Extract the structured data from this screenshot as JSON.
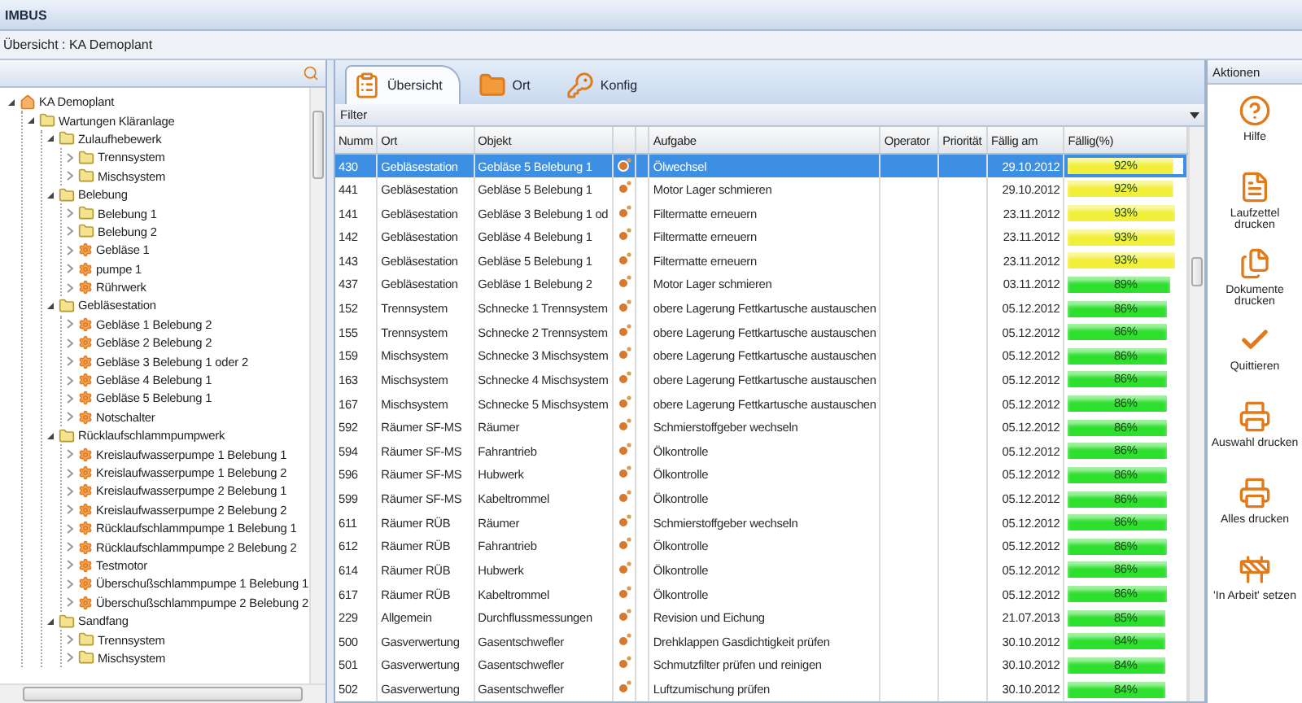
{
  "window": {
    "title": "IMBUS"
  },
  "breadcrumb": "Übersicht : KA Demoplant",
  "tree": [
    {
      "label": "KA Demoplant",
      "kind": "home",
      "expanded": true,
      "children": [
        {
          "label": "Wartungen Kläranlage",
          "kind": "folder",
          "expanded": true,
          "children": [
            {
              "label": "Zulaufhebewerk",
              "kind": "folder",
              "expanded": true,
              "children": [
                {
                  "label": "Trennsystem",
                  "kind": "folder",
                  "expanded": false
                },
                {
                  "label": "Mischsystem",
                  "kind": "folder",
                  "expanded": false
                }
              ]
            },
            {
              "label": "Belebung",
              "kind": "folder",
              "expanded": true,
              "children": [
                {
                  "label": "Belebung 1",
                  "kind": "folder",
                  "expanded": false
                },
                {
                  "label": "Belebung 2",
                  "kind": "folder",
                  "expanded": false
                },
                {
                  "label": "Gebläse 1",
                  "kind": "device",
                  "expanded": false
                },
                {
                  "label": "pumpe 1",
                  "kind": "device",
                  "expanded": false
                },
                {
                  "label": "Rührwerk",
                  "kind": "device",
                  "expanded": false
                }
              ]
            },
            {
              "label": "Gebläsestation",
              "kind": "folder",
              "expanded": true,
              "children": [
                {
                  "label": "Gebläse 1 Belebung 2",
                  "kind": "device",
                  "expanded": false
                },
                {
                  "label": "Gebläse 2 Belebung 2",
                  "kind": "device",
                  "expanded": false
                },
                {
                  "label": "Gebläse 3 Belebung 1 oder 2",
                  "kind": "device",
                  "expanded": false
                },
                {
                  "label": "Gebläse 4 Belebung 1",
                  "kind": "device",
                  "expanded": false
                },
                {
                  "label": "Gebläse 5 Belebung 1",
                  "kind": "device",
                  "expanded": false
                },
                {
                  "label": "Notschalter",
                  "kind": "device",
                  "expanded": false
                }
              ]
            },
            {
              "label": "Rücklaufschlammpumpwerk",
              "kind": "folder",
              "expanded": true,
              "children": [
                {
                  "label": "Kreislaufwasserpumpe 1 Belebung 1",
                  "kind": "device",
                  "expanded": false
                },
                {
                  "label": "Kreislaufwasserpumpe 1 Belebung 2",
                  "kind": "device",
                  "expanded": false
                },
                {
                  "label": "Kreislaufwasserpumpe 2 Belebung 1",
                  "kind": "device",
                  "expanded": false
                },
                {
                  "label": "Kreislaufwasserpumpe 2 Belebung 2",
                  "kind": "device",
                  "expanded": false
                },
                {
                  "label": "Rücklaufschlammpumpe 1 Belebung 1",
                  "kind": "device",
                  "expanded": false
                },
                {
                  "label": "Rücklaufschlammpumpe 2 Belebung 2",
                  "kind": "device",
                  "expanded": false
                },
                {
                  "label": "Testmotor",
                  "kind": "device",
                  "expanded": false
                },
                {
                  "label": "Überschußschlammpumpe 1 Belebung 1",
                  "kind": "device",
                  "expanded": false
                },
                {
                  "label": "Überschußschlammpumpe 2 Belebung 2",
                  "kind": "device",
                  "expanded": false
                }
              ]
            },
            {
              "label": "Sandfang",
              "kind": "folder",
              "expanded": true,
              "children": [
                {
                  "label": "Trennsystem",
                  "kind": "folder",
                  "expanded": false
                },
                {
                  "label": "Mischsystem",
                  "kind": "folder",
                  "expanded": false
                }
              ]
            }
          ]
        }
      ]
    }
  ],
  "tabs": [
    {
      "label": "Übersicht",
      "kind": "overview",
      "selected": true
    },
    {
      "label": "Ort",
      "kind": "folder",
      "selected": false
    },
    {
      "label": "Konfig",
      "kind": "key",
      "selected": false
    }
  ],
  "filter": "Filter",
  "table": {
    "columns": [
      "Numm",
      "Ort",
      "Objekt",
      "",
      "",
      "Aufgabe",
      "Operator",
      "Priorität",
      "Fällig am",
      "Fällig(%)"
    ],
    "rows": [
      {
        "num": "430",
        "ort": "Gebläsestation",
        "objekt": "Gebläse 5 Belebung 1",
        "aufgabe": "Ölwechsel",
        "faellig": "29.10.2012",
        "percent": "92%",
        "level": 0.92,
        "color": "#f2ef3a",
        "selected": true
      },
      {
        "num": "441",
        "ort": "Gebläsestation",
        "objekt": "Gebläse 5 Belebung 1",
        "aufgabe": "Motor Lager schmieren",
        "faellig": "29.10.2012",
        "percent": "92%",
        "level": 0.92,
        "color": "#f2ef3a",
        "selected": false
      },
      {
        "num": "141",
        "ort": "Gebläsestation",
        "objekt": "Gebläse 3 Belebung 1 od",
        "aufgabe": "Filtermatte erneuern",
        "faellig": "23.11.2012",
        "percent": "93%",
        "level": 0.93,
        "color": "#f2ef3a",
        "selected": false
      },
      {
        "num": "142",
        "ort": "Gebläsestation",
        "objekt": "Gebläse 4 Belebung 1",
        "aufgabe": "Filtermatte erneuern",
        "faellig": "23.11.2012",
        "percent": "93%",
        "level": 0.93,
        "color": "#f2ef3a",
        "selected": false
      },
      {
        "num": "143",
        "ort": "Gebläsestation",
        "objekt": "Gebläse 5 Belebung 1",
        "aufgabe": "Filtermatte erneuern",
        "faellig": "23.11.2012",
        "percent": "93%",
        "level": 0.93,
        "color": "#f2ef3a",
        "selected": false
      },
      {
        "num": "437",
        "ort": "Gebläsestation",
        "objekt": "Gebläse 1 Belebung 2",
        "aufgabe": "Motor Lager schmieren",
        "faellig": "03.11.2012",
        "percent": "89%",
        "level": 0.89,
        "color": "#2ee02e",
        "selected": false
      },
      {
        "num": "152",
        "ort": "Trennsystem",
        "objekt": "Schnecke 1 Trennsystem",
        "aufgabe": "obere Lagerung Fettkartusche austauschen",
        "faellig": "05.12.2012",
        "percent": "86%",
        "level": 0.86,
        "color": "#2ee02e",
        "selected": false
      },
      {
        "num": "155",
        "ort": "Trennsystem",
        "objekt": "Schnecke 2 Trennsystem",
        "aufgabe": "obere Lagerung Fettkartusche austauschen",
        "faellig": "05.12.2012",
        "percent": "86%",
        "level": 0.86,
        "color": "#2ee02e",
        "selected": false
      },
      {
        "num": "159",
        "ort": "Mischsystem",
        "objekt": "Schnecke 3 Mischsystem",
        "aufgabe": "obere Lagerung Fettkartusche austauschen",
        "faellig": "05.12.2012",
        "percent": "86%",
        "level": 0.86,
        "color": "#2ee02e",
        "selected": false
      },
      {
        "num": "163",
        "ort": "Mischsystem",
        "objekt": "Schnecke 4 Mischsystem",
        "aufgabe": "obere Lagerung Fettkartusche austauschen",
        "faellig": "05.12.2012",
        "percent": "86%",
        "level": 0.86,
        "color": "#2ee02e",
        "selected": false
      },
      {
        "num": "167",
        "ort": "Mischsystem",
        "objekt": "Schnecke 5 Mischsystem",
        "aufgabe": "obere Lagerung Fettkartusche austauschen",
        "faellig": "05.12.2012",
        "percent": "86%",
        "level": 0.86,
        "color": "#2ee02e",
        "selected": false
      },
      {
        "num": "592",
        "ort": "Räumer SF-MS",
        "objekt": "Räumer",
        "aufgabe": "Schmierstoffgeber wechseln",
        "faellig": "05.12.2012",
        "percent": "86%",
        "level": 0.86,
        "color": "#2ee02e",
        "selected": false
      },
      {
        "num": "594",
        "ort": "Räumer SF-MS",
        "objekt": "Fahrantrieb",
        "aufgabe": "Ölkontrolle",
        "faellig": "05.12.2012",
        "percent": "86%",
        "level": 0.86,
        "color": "#2ee02e",
        "selected": false
      },
      {
        "num": "596",
        "ort": "Räumer SF-MS",
        "objekt": "Hubwerk",
        "aufgabe": "Ölkontrolle",
        "faellig": "05.12.2012",
        "percent": "86%",
        "level": 0.86,
        "color": "#2ee02e",
        "selected": false
      },
      {
        "num": "599",
        "ort": "Räumer SF-MS",
        "objekt": "Kabeltrommel",
        "aufgabe": "Ölkontrolle",
        "faellig": "05.12.2012",
        "percent": "86%",
        "level": 0.86,
        "color": "#2ee02e",
        "selected": false
      },
      {
        "num": "611",
        "ort": "Räumer RÜB",
        "objekt": "Räumer",
        "aufgabe": "Schmierstoffgeber wechseln",
        "faellig": "05.12.2012",
        "percent": "86%",
        "level": 0.86,
        "color": "#2ee02e",
        "selected": false
      },
      {
        "num": "612",
        "ort": "Räumer RÜB",
        "objekt": "Fahrantrieb",
        "aufgabe": "Ölkontrolle",
        "faellig": "05.12.2012",
        "percent": "86%",
        "level": 0.86,
        "color": "#2ee02e",
        "selected": false
      },
      {
        "num": "614",
        "ort": "Räumer RÜB",
        "objekt": "Hubwerk",
        "aufgabe": "Ölkontrolle",
        "faellig": "05.12.2012",
        "percent": "86%",
        "level": 0.86,
        "color": "#2ee02e",
        "selected": false
      },
      {
        "num": "617",
        "ort": "Räumer RÜB",
        "objekt": "Kabeltrommel",
        "aufgabe": "Ölkontrolle",
        "faellig": "05.12.2012",
        "percent": "86%",
        "level": 0.86,
        "color": "#2ee02e",
        "selected": false
      },
      {
        "num": "229",
        "ort": "Allgemein",
        "objekt": "Durchflussmessungen",
        "aufgabe": "Revision und Eichung",
        "faellig": "21.07.2013",
        "percent": "85%",
        "level": 0.85,
        "color": "#2ee02e",
        "selected": false
      },
      {
        "num": "500",
        "ort": "Gasverwertung",
        "objekt": "Gasentschwefler",
        "aufgabe": "Drehklappen Gasdichtigkeit prüfen",
        "faellig": "30.10.2012",
        "percent": "84%",
        "level": 0.84,
        "color": "#2ee02e",
        "selected": false
      },
      {
        "num": "501",
        "ort": "Gasverwertung",
        "objekt": "Gasentschwefler",
        "aufgabe": "Schmutzfilter prüfen und reinigen",
        "faellig": "30.10.2012",
        "percent": "84%",
        "level": 0.84,
        "color": "#2ee02e",
        "selected": false
      },
      {
        "num": "502",
        "ort": "Gasverwertung",
        "objekt": "Gasentschwefler",
        "aufgabe": "Luftzumischung prüfen",
        "faellig": "30.10.2012",
        "percent": "84%",
        "level": 0.84,
        "color": "#2ee02e",
        "selected": false
      }
    ]
  },
  "actions": {
    "title": "Aktionen",
    "items": [
      {
        "label": "Hilfe",
        "kind": "help"
      },
      {
        "label": "Laufzettel drucken",
        "kind": "sheet"
      },
      {
        "label": "Dokumente drucken",
        "kind": "documents"
      },
      {
        "label": "Quittieren",
        "kind": "check"
      },
      {
        "label": "Auswahl drucken",
        "kind": "print"
      },
      {
        "label": "Alles drucken",
        "kind": "print"
      },
      {
        "label": "'In Arbeit' setzen",
        "kind": "worker"
      }
    ]
  }
}
